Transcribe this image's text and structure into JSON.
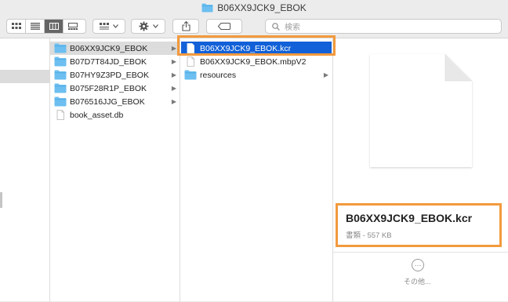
{
  "window": {
    "title": "B06XX9JCK9_EBOK",
    "folder_color": "#6cbff0"
  },
  "toolbar": {
    "view_modes": [
      "icon-view",
      "list-view",
      "column-view",
      "gallery-view"
    ],
    "active_view": "column-view",
    "search_placeholder": "検索"
  },
  "columns": {
    "col1": [
      {
        "label": "B06XX9JCK9_EBOK",
        "type": "folder",
        "has_children": true,
        "selected": "gray"
      },
      {
        "label": "B07D7T84JD_EBOK",
        "type": "folder",
        "has_children": true
      },
      {
        "label": "B07HY9Z3PD_EBOK",
        "type": "folder",
        "has_children": true
      },
      {
        "label": "B075F28R1P_EBOK",
        "type": "folder",
        "has_children": true
      },
      {
        "label": "B076516JJG_EBOK",
        "type": "folder",
        "has_children": true
      },
      {
        "label": "book_asset.db",
        "type": "file",
        "has_children": false
      }
    ],
    "col2": [
      {
        "label": "B06XX9JCK9_EBOK.kcr",
        "type": "file",
        "has_children": false,
        "selected": "blue"
      },
      {
        "label": "B06XX9JCK9_EBOK.mbpV2",
        "type": "file",
        "has_children": false
      },
      {
        "label": "resources",
        "type": "folder",
        "has_children": true
      }
    ]
  },
  "preview": {
    "filename": "B06XX9JCK9_EBOK.kcr",
    "meta": "書類 - 557 KB",
    "more_label": "その他...",
    "more_symbol": "···"
  },
  "colors": {
    "highlight": "#f29a3d",
    "selection_blue": "#1261d8",
    "selection_gray": "#dcdcdc"
  }
}
